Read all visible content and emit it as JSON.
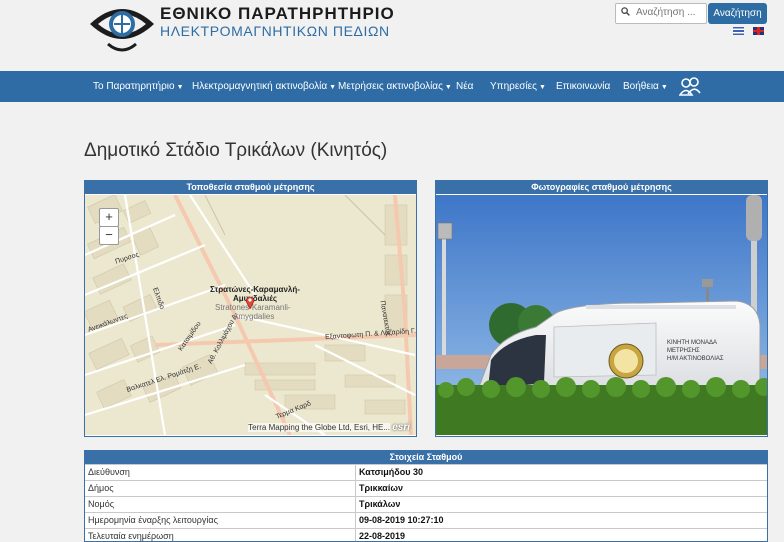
{
  "header": {
    "logo_line1": "ΕΘΝΙΚΟ ΠΑΡΑΤΗΡΗΤΗΡΙΟ",
    "logo_line2": "ΗΛΕΚΤΡΟΜΑΓΝΗΤΙΚΩΝ ΠΕΔΙΩΝ",
    "search_placeholder": "Αναζήτηση ...",
    "search_button": "Αναζήτηση",
    "languages": [
      "greek-flag",
      "uk-flag"
    ]
  },
  "nav": {
    "items": [
      {
        "label": "Το Παρατηρητήριο",
        "caret": true
      },
      {
        "label": "Ηλεκτρομαγνητική ακτινοβολία",
        "caret": true
      },
      {
        "label": "Μετρήσεις ακτινοβολίας",
        "caret": true
      },
      {
        "label": "Νέα",
        "caret": false
      },
      {
        "label": "Υπηρεσίες",
        "caret": true
      },
      {
        "label": "Επικοινωνία",
        "caret": false
      },
      {
        "label": "Βοήθεια",
        "caret": true
      }
    ],
    "icon": "users-icon"
  },
  "page": {
    "title": "Δημοτικό Στάδιο Τρικάλων (Κινητός)"
  },
  "map_panel": {
    "heading": "Τοποθεσία σταθμού μέτρησης",
    "zoom_in": "+",
    "zoom_out": "−",
    "place_label_1": "Στρατώνες-Καραμανλή-",
    "place_label_2": "Αμυγδαλιές",
    "place_label_3": "Stratones-Karamanli-",
    "place_label_4": "Amygdalies",
    "street_1": "Καταιμίδου",
    "street_2": "Αθ. Κολλιμάχου Δ.",
    "street_3": "Εξαντοφωτη Π. & Λαζαρίδη Γ.",
    "street_4": "Βαλκατελ Ελ. Ρομάτζη Ε.",
    "street_5": "Ανεικάλωντες",
    "street_6": "Πανατεκτος",
    "street_7": "Ελπιδο",
    "street_8": "Πυρσος",
    "street_9": "Τερμα Καρδ",
    "attribution": "Terra Mapping the Globe Ltd, Esri, HE...",
    "esri": "esri"
  },
  "photo_panel": {
    "heading": "Φωτογραφίες σταθμού μέτρησης",
    "van_text_1": "ΚΙΝΗΤΗ ΜΟΝΑΔΑ",
    "van_text_2": "ΜΕΤΡΗΣΗΣ",
    "van_text_3": "Η/Μ ΑΚΤΙΝΟΒΟΛΙΑΣ"
  },
  "station": {
    "heading": "Στοιχεία Σταθμού",
    "rows": [
      {
        "key": "Διεύθυνση",
        "value": "Κατσιμήδου 30"
      },
      {
        "key": "Δήμος",
        "value": "Τρικκαίων"
      },
      {
        "key": "Νομός",
        "value": "Τρικάλων"
      },
      {
        "key": "Ημερομηνία έναρξης λειτουργίας",
        "value": "09-08-2019 10:27:10"
      },
      {
        "key": "Τελευταία ενημέρωση",
        "value": "22-08-2019"
      }
    ]
  },
  "colors": {
    "accent": "#2f6ca6",
    "panel_header": "#3a70a8"
  }
}
